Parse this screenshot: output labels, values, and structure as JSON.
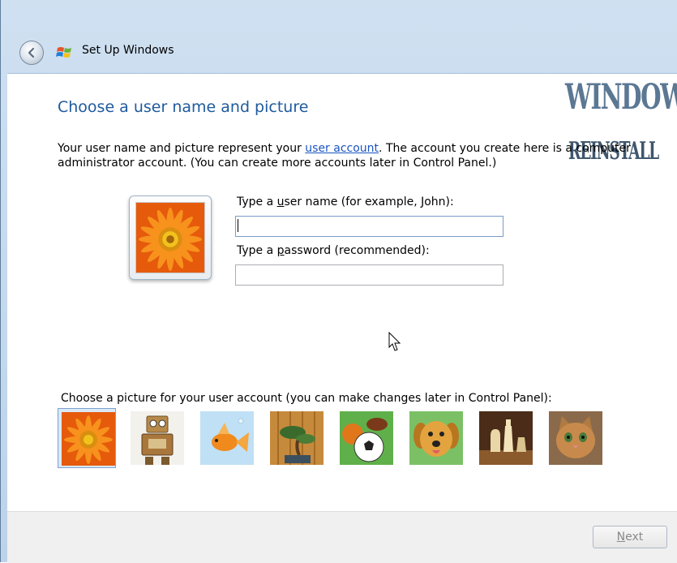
{
  "window": {
    "title": "Set Up Windows",
    "icons": {
      "back": "back-arrow-icon",
      "logo": "windows-logo-icon"
    }
  },
  "watermark": {
    "line1": "WINDOWS",
    "line2": "REINSTALL"
  },
  "page": {
    "heading": "Choose a user name and picture",
    "desc_before_link": "Your user name and picture represent your ",
    "desc_link": "user account",
    "desc_after_link": ". The account you create here is a computer administrator account. (You can create more accounts later in Control Panel.)"
  },
  "form": {
    "username_label_prefix": "Type a ",
    "username_label_access": "u",
    "username_label_suffix": "ser name (for example, John):",
    "username_value": "",
    "password_label_prefix": "Type a ",
    "password_label_access": "p",
    "password_label_suffix": "assword (recommended):",
    "password_value": ""
  },
  "pictures": {
    "label": "Choose a picture for your user account (you can make changes later in Control Panel):",
    "items": [
      {
        "name": "flower",
        "selected": true
      },
      {
        "name": "robot",
        "selected": false
      },
      {
        "name": "goldfish",
        "selected": false
      },
      {
        "name": "bonsai",
        "selected": false
      },
      {
        "name": "sports-balls",
        "selected": false
      },
      {
        "name": "puppy",
        "selected": false
      },
      {
        "name": "chess",
        "selected": false
      },
      {
        "name": "kitten",
        "selected": false
      }
    ]
  },
  "footer": {
    "next_prefix": "",
    "next_access": "N",
    "next_suffix": "ext"
  },
  "colors": {
    "heading": "#1e5a9e",
    "link": "#1c55c2",
    "titlebar": "#c4d8ec",
    "footer": "#f0f0f0"
  }
}
